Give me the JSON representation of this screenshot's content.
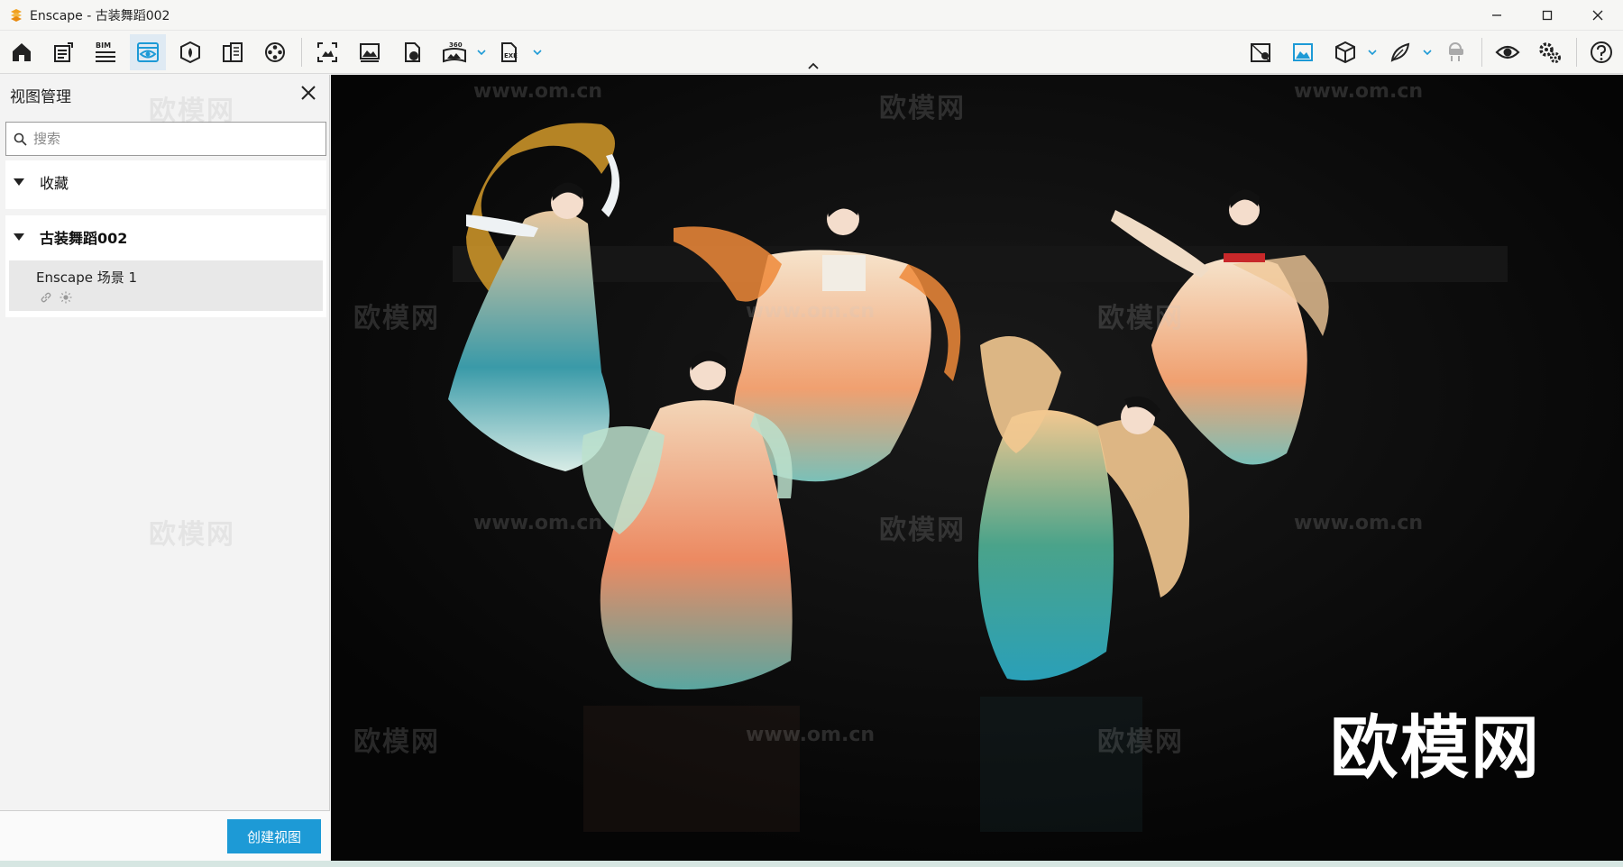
{
  "window": {
    "title": "Enscape - 古装舞蹈002",
    "controls": [
      "minimize-icon",
      "maximize-icon",
      "close-icon"
    ]
  },
  "toolbar": {
    "left_tools": [
      {
        "name": "home-icon",
        "active": false
      },
      {
        "name": "notes-icon",
        "active": false
      },
      {
        "name": "bim-icon",
        "label": "BIM",
        "active": false
      },
      {
        "name": "views-eye-icon",
        "active": true
      },
      {
        "name": "atmosphere-icon",
        "active": false
      },
      {
        "name": "asset-library-icon",
        "active": false
      },
      {
        "name": "video-reel-icon",
        "active": false
      }
    ],
    "capture_tools": [
      {
        "name": "screenshot-icon"
      },
      {
        "name": "batch-render-icon"
      },
      {
        "name": "export-web-icon"
      },
      {
        "name": "panorama-360-icon",
        "label": "360",
        "dropdown": true
      },
      {
        "name": "export-exe-icon",
        "label": "EXE",
        "dropdown": true
      }
    ],
    "right_tools": [
      {
        "name": "map-pin-icon"
      },
      {
        "name": "render-window-icon"
      },
      {
        "name": "view-cube-icon",
        "dropdown": true
      },
      {
        "name": "feather-icon",
        "dropdown": true
      },
      {
        "name": "vr-headset-icon"
      },
      {
        "name": "visual-settings-eye-icon"
      },
      {
        "name": "settings-gears-icon"
      },
      {
        "name": "help-icon"
      }
    ]
  },
  "panel": {
    "title": "视图管理",
    "search_placeholder": "搜索",
    "favorites_label": "收藏",
    "project_label": "古装舞蹈002",
    "scenes": [
      {
        "name": "Enscape 场景 1"
      }
    ],
    "create_button": "创建视图"
  },
  "viewport": {
    "watermark_text": "欧模网",
    "watermark_url": "www.om.cn",
    "big_watermark": "欧模网"
  },
  "colors": {
    "accent": "#1d9ad6",
    "active_tool_bg": "#dfeaf3",
    "viewport_bg": "#050505"
  }
}
